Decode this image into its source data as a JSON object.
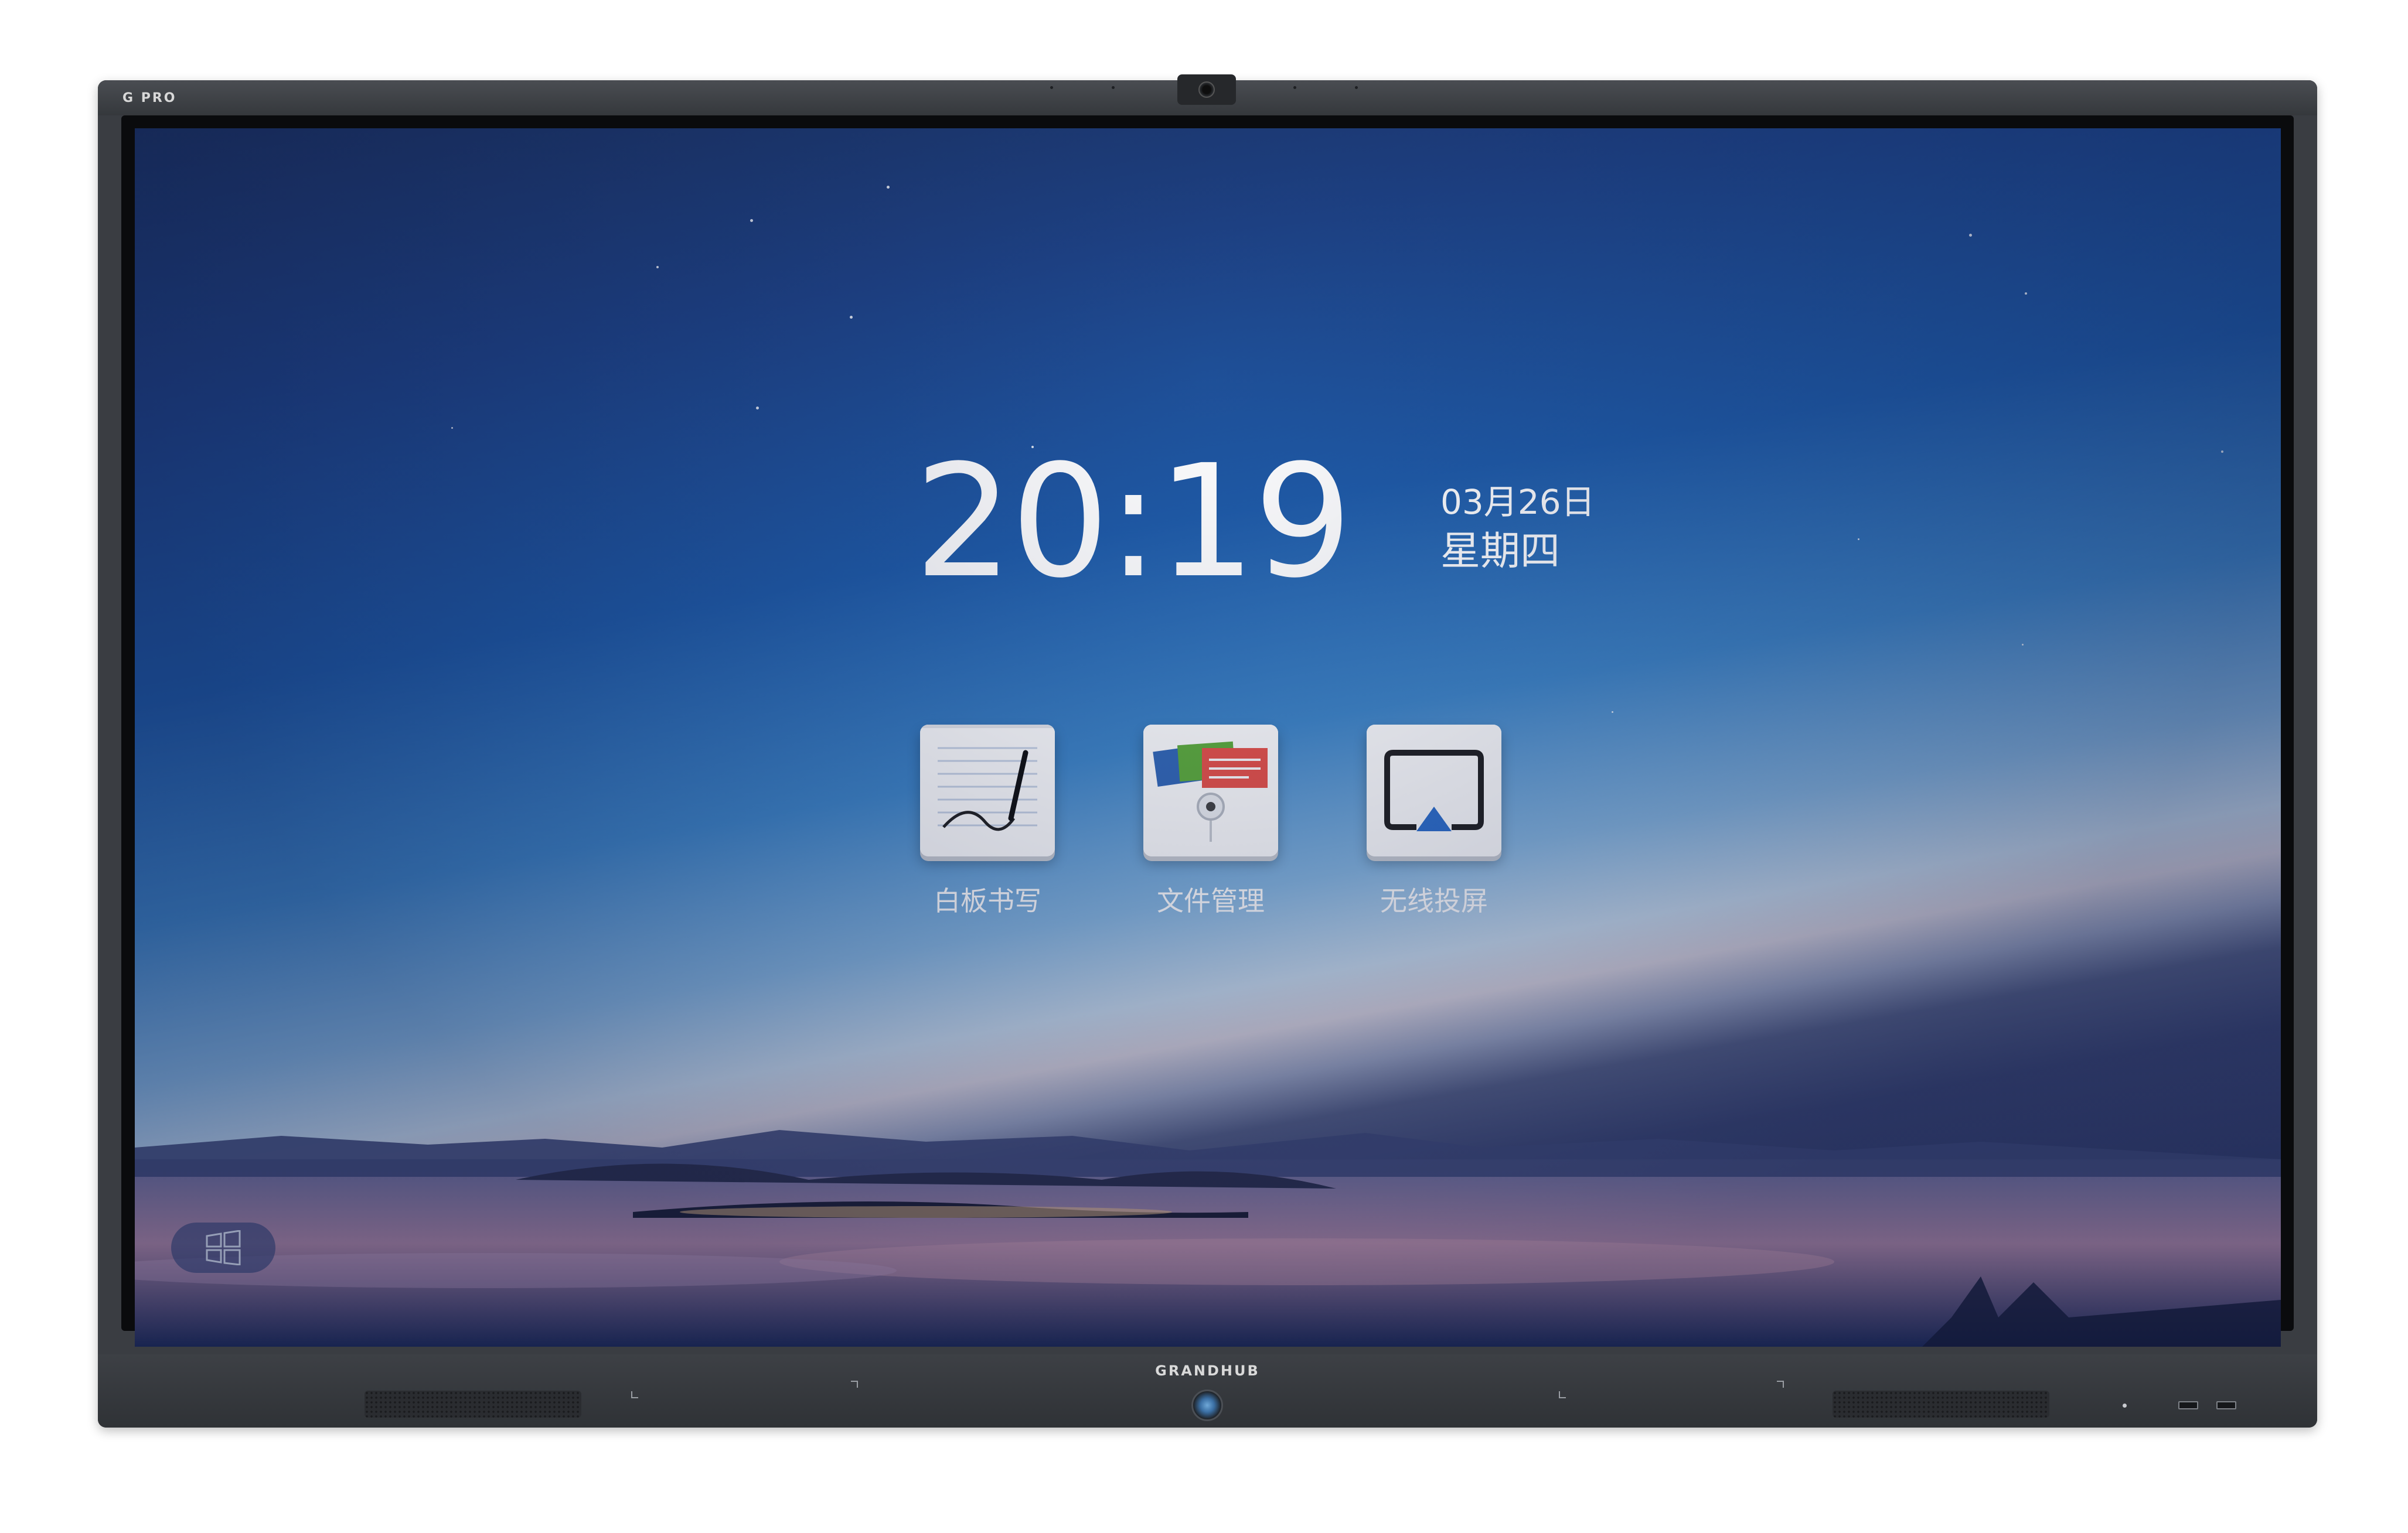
{
  "device": {
    "model_label": "G PRO",
    "brand": "GRANDHUB"
  },
  "home": {
    "time": "20:19",
    "date": "03月26日",
    "weekday": "星期四"
  },
  "apps": [
    {
      "label": "白板书写",
      "icon": "whiteboard-icon"
    },
    {
      "label": "文件管理",
      "icon": "file-manager-icon"
    },
    {
      "label": "无线投屏",
      "icon": "wireless-cast-icon"
    }
  ],
  "taskbar": {
    "start_icon": "windows-icon"
  },
  "colors": {
    "sky_top": "#1c3260",
    "sky_mid": "#1f5ba8",
    "horizon": "#c9dced",
    "bezel": "#3a3d42",
    "cast_accent": "#2f6fcb"
  }
}
